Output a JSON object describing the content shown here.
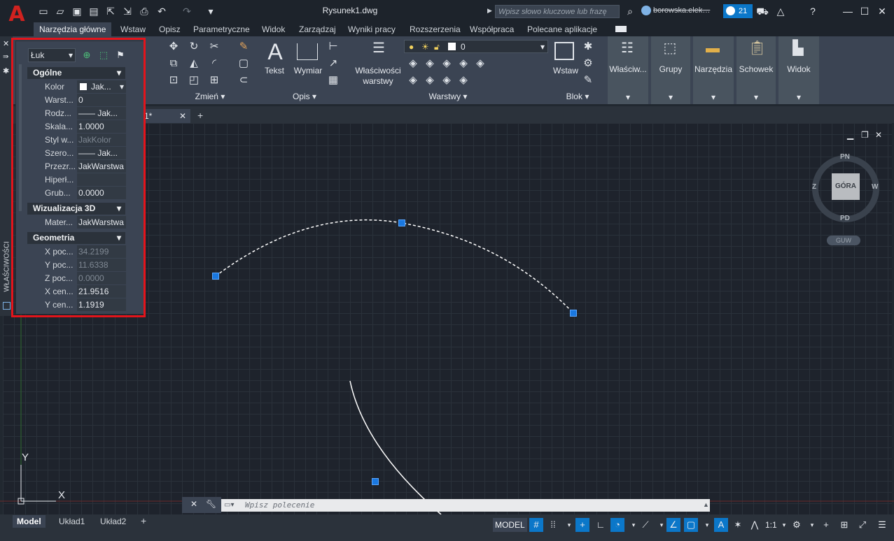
{
  "app": {
    "logo": "A"
  },
  "title": {
    "document": "Rysunek1.dwg"
  },
  "search": {
    "placeholder": "Wpisz słowo kluczowe lub frazę"
  },
  "account": {
    "user": "borowska.elek…",
    "badge_count": "21"
  },
  "ribbon_tabs": [
    "Narzędzia główne",
    "Wstaw",
    "Opisz",
    "Parametryczne",
    "Widok",
    "Zarządzaj",
    "Wyniki pracy",
    "Rozszerzenia",
    "Współpraca",
    "Polecane aplikacje"
  ],
  "ribbon": {
    "modify_panel": "Zmień",
    "annotation": {
      "text": "Tekst",
      "dimension": "Wymiar",
      "panel": "Opis"
    },
    "layers": {
      "properties_line1": "Właściwości",
      "properties_line2": "warstwy",
      "current_layer": "0",
      "panel": "Warstwy"
    },
    "block": {
      "insert": "Wstaw",
      "panel": "Blok"
    },
    "gray_panels": [
      "Właściw...",
      "Grupy",
      "Narzędzia",
      "Schowek",
      "Widok"
    ]
  },
  "doc_tab": {
    "name": "k1*"
  },
  "properties": {
    "side_label": "WŁAŚCIWOŚCI",
    "object_type": "Łuk",
    "sections": {
      "general": {
        "title": "Ogólne",
        "rows": [
          {
            "k": "Kolor",
            "v": "Jak..."
          },
          {
            "k": "Warst...",
            "v": "0"
          },
          {
            "k": "Rodz...",
            "v": "—— Jak..."
          },
          {
            "k": "Skala...",
            "v": "1.0000"
          },
          {
            "k": "Styl w...",
            "v": "JakKolor"
          },
          {
            "k": "Szero...",
            "v": "—— Jak..."
          },
          {
            "k": "Przezr...",
            "v": "JakWarstwa"
          },
          {
            "k": "Hiperł...",
            "v": ""
          },
          {
            "k": "Grub...",
            "v": "0.0000"
          }
        ]
      },
      "viz3d": {
        "title": "Wizualizacja 3D",
        "rows": [
          {
            "k": "Mater...",
            "v": "JakWarstwa"
          }
        ]
      },
      "geometry": {
        "title": "Geometria",
        "rows": [
          {
            "k": "X poc...",
            "v": "34.2199"
          },
          {
            "k": "Y poc...",
            "v": "11.6338"
          },
          {
            "k": "Z poc...",
            "v": "0.0000"
          },
          {
            "k": "X cen...",
            "v": "21.9516"
          },
          {
            "k": "Y cen...",
            "v": "1.1919"
          }
        ]
      }
    }
  },
  "viewcube": {
    "top": "GÓRA",
    "north": "PN",
    "south": "PD",
    "east": "W",
    "west": "Z",
    "wcs": "GUW"
  },
  "ucs": {
    "x": "X",
    "y": "Y"
  },
  "command": {
    "placeholder": "Wpisz polecenie"
  },
  "layout_tabs": [
    "Model",
    "Układ1",
    "Układ2"
  ],
  "status": {
    "model": "MODEL",
    "scale": "1:1"
  }
}
